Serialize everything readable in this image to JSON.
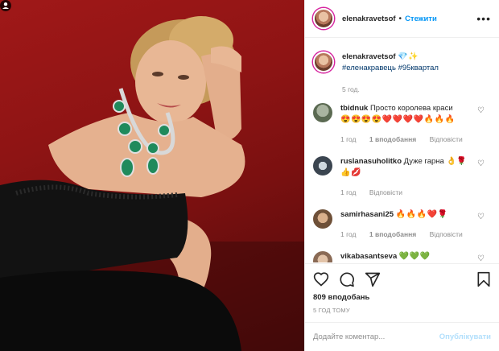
{
  "header": {
    "username": "elenakravetsof",
    "separator": "•",
    "follow_label": "Стежити",
    "more_icon": "more-horizontal-icon"
  },
  "caption": {
    "username": "elenakravetsof",
    "emojis": "💎✨",
    "hashtags": "#еленакравець #95квартал",
    "time": "5 год."
  },
  "comments": [
    {
      "username": "tbidnuk",
      "text": "Просто королева краси",
      "emojis": "😍😍😍😍❤️❤️❤️❤️🔥🔥🔥",
      "time": "1 год",
      "likes": "1 вподобання",
      "reply": "Відповісти"
    },
    {
      "username": "ruslanasuholitko",
      "text": "Дуже гарна",
      "emojis": "👌🌹👍💋",
      "time": "1 год",
      "reply": "Відповісти"
    },
    {
      "username": "samirhasani25",
      "text": "",
      "emojis": "🔥🔥🔥❤️🌹",
      "time": "1 год",
      "likes": "1 вподобання",
      "reply": "Відповісти"
    },
    {
      "username": "vikabasantseva",
      "text": "",
      "emojis": "💚💚💚"
    }
  ],
  "actions": {
    "likes": "809 вподобань",
    "ago": "5 ГОД ТОМУ"
  },
  "add_comment": {
    "placeholder": "Додайте коментар...",
    "post_label": "Опублікувати"
  },
  "colors": {
    "accent": "#0095f6",
    "post_disabled": "#b2dffc",
    "background_red": "#8e1414"
  }
}
